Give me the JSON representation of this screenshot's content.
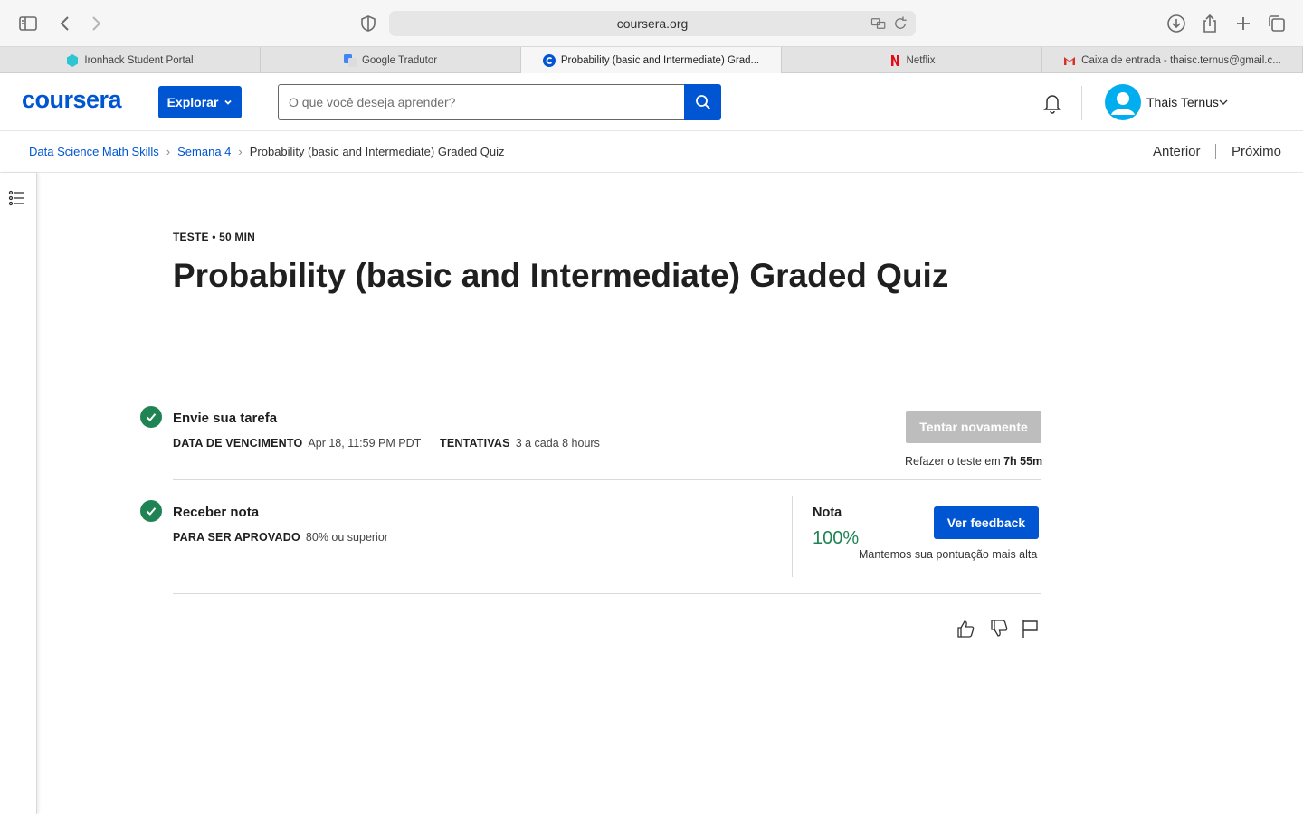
{
  "browser": {
    "url": "coursera.org",
    "tabs": [
      {
        "label": "Ironhack Student Portal",
        "favicon_color": "#2ec5d3",
        "active": false
      },
      {
        "label": "Google Tradutor",
        "favicon_color": "#4285f4",
        "active": false
      },
      {
        "label": "Probability (basic and Intermediate) Grad...",
        "favicon_color": "#0056d2",
        "active": true
      },
      {
        "label": "Netflix",
        "favicon_color": "#e50914",
        "active": false
      },
      {
        "label": "Caixa de entrada - thaisc.ternus@gmail.c...",
        "favicon_color": "#d93025",
        "active": false
      }
    ]
  },
  "header": {
    "logo": "coursera",
    "explore_label": "Explorar",
    "search_placeholder": "O que você deseja aprender?",
    "user_name": "Thais Ternus"
  },
  "breadcrumb": {
    "items": [
      "Data Science Math Skills",
      "Semana 4",
      "Probability (basic and Intermediate) Graded Quiz"
    ],
    "prev_label": "Anterior",
    "next_label": "Próximo"
  },
  "quiz": {
    "meta": "TESTE • 50 MIN",
    "title": "Probability (basic and Intermediate) Graded Quiz"
  },
  "submit_section": {
    "title": "Envie sua tarefa",
    "due_label": "DATA DE VENCIMENTO",
    "due_value": "Apr 18, 11:59 PM PDT",
    "attempts_label": "TENTATIVAS",
    "attempts_value": "3 a cada 8 hours",
    "retry_button": "Tentar novamente",
    "retry_note_prefix": "Refazer o teste em",
    "retry_note_time": "7h 55m"
  },
  "grade_section": {
    "title": "Receber nota",
    "pass_label": "PARA SER APROVADO",
    "pass_value": "80% ou superior",
    "grade_label": "Nota",
    "grade_value": "100%",
    "grade_note": "Mantemos sua pontuação mais alta",
    "feedback_button": "Ver feedback"
  },
  "colors": {
    "brand_blue": "#0056d2",
    "success_green": "#1f8354",
    "disabled_gray": "#bdbdbd"
  },
  "icons": [
    "sidebar-icon",
    "back-icon",
    "forward-icon",
    "shield-icon",
    "translate-icon",
    "reload-icon",
    "download-icon",
    "share-icon",
    "new-tab-icon",
    "tab-overview-icon",
    "search-icon",
    "bell-icon",
    "avatar-icon",
    "chevron-down-icon",
    "list-icon",
    "check-icon",
    "thumbs-up-icon",
    "thumbs-down-icon",
    "flag-icon"
  ]
}
